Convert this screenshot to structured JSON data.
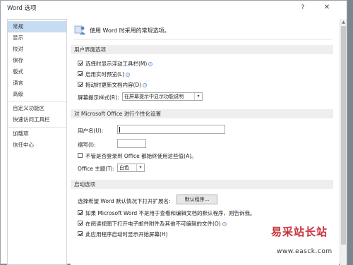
{
  "window": {
    "title": "Word 选项",
    "help_label": "?",
    "close_label": "✕"
  },
  "sidebar": {
    "items": [
      {
        "label": "常规",
        "selected": true
      },
      {
        "label": "显示"
      },
      {
        "label": "校对"
      },
      {
        "label": "保存"
      },
      {
        "label": "版式"
      },
      {
        "label": "语言"
      },
      {
        "label": "高级"
      },
      {
        "label": "自定义功能区"
      },
      {
        "label": "快速访问工具栏"
      },
      {
        "label": "加载项"
      },
      {
        "label": "信任中心"
      }
    ]
  },
  "main": {
    "intro": "使用 Word 时采用的常规选项。",
    "ui_section": {
      "header": "用户界面选项",
      "show_mini_toolbar": {
        "label": "选择时显示浮动工具栏(M)",
        "checked": true
      },
      "live_preview": {
        "label": "启用实时预览(L)",
        "checked": true
      },
      "update_while_dragging": {
        "label": "拖动时更新文档内容(D)",
        "checked": true
      },
      "screentip_label": "屏幕提示样式(R):",
      "screentip_value": "在屏幕提示中显示功能说明"
    },
    "personalize_section": {
      "header": "对 Microsoft Office 进行个性化设置",
      "username_label": "用户名(U):",
      "username_value": "",
      "initials_label": "缩写(I):",
      "initials_value": "",
      "always_use": {
        "label": "不管是否登录到 Office 都始终使用这些值(A)。",
        "checked": false
      },
      "theme_label": "Office 主题(T):",
      "theme_value": "白色"
    },
    "startup_section": {
      "header": "启动选项",
      "default_ext_label": "选择希望 Word 默认情况下打开扩展名:",
      "default_programs_button": "默认程序...",
      "tell_me": {
        "label": "如果 Microsoft Word 不是用于查看和编辑文档的默认程序，则告诉我。",
        "checked": true
      },
      "reading_view": {
        "label": "在阅读视图下打开电子邮件附件及其他不可编辑的文件(O)",
        "checked": true
      },
      "start_screen": {
        "label": "此应用程序启动时显示开始屏幕(H)",
        "checked": true
      }
    }
  },
  "watermark": {
    "line1": "易采站长站",
    "line2": "www.easck.com"
  }
}
